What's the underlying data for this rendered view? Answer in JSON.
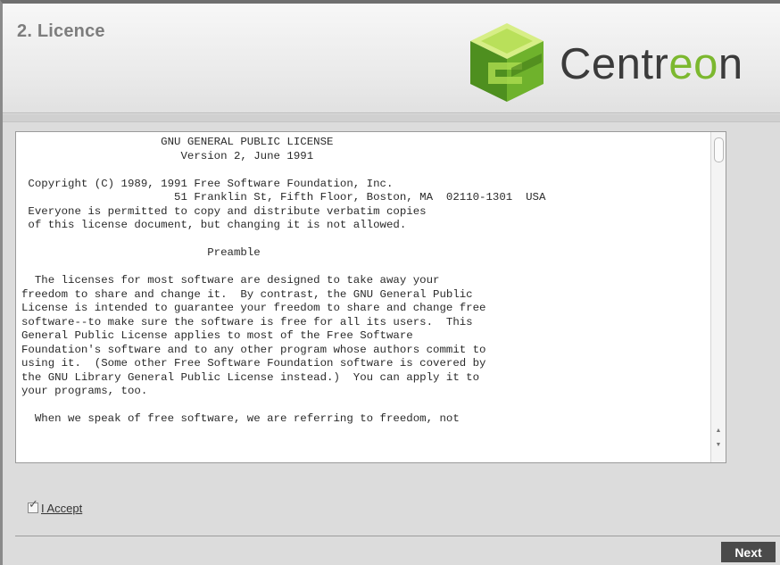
{
  "header": {
    "step_title": "2. Licence",
    "logo_text_prefix": "Centr",
    "logo_text_accent": "eo",
    "logo_text_suffix": "n"
  },
  "license": {
    "text": "                     GNU GENERAL PUBLIC LICENSE\n                        Version 2, June 1991\n\n Copyright (C) 1989, 1991 Free Software Foundation, Inc.\n                       51 Franklin St, Fifth Floor, Boston, MA  02110-1301  USA\n Everyone is permitted to copy and distribute verbatim copies\n of this license document, but changing it is not allowed.\n\n                            Preamble\n\n  The licenses for most software are designed to take away your\nfreedom to share and change it.  By contrast, the GNU General Public\nLicense is intended to guarantee your freedom to share and change free\nsoftware--to make sure the software is free for all its users.  This\nGeneral Public License applies to most of the Free Software\nFoundation's software and to any other program whose authors commit to\nusing it.  (Some other Free Software Foundation software is covered by\nthe GNU Library General Public License instead.)  You can apply it to\nyour programs, too.\n\n  When we speak of free software, we are referring to freedom, not"
  },
  "accept": {
    "label": "I Accept",
    "checked": true
  },
  "footer": {
    "next_label": "Next"
  },
  "colors": {
    "brand_green": "#7cb82f",
    "next_button_bg": "#4a4a4a"
  },
  "icons": {
    "logo": "centreon-cube-logo",
    "scroll_up": "scroll-up-arrow",
    "scroll_down": "scroll-down-arrow",
    "checkbox": "checkmark"
  }
}
